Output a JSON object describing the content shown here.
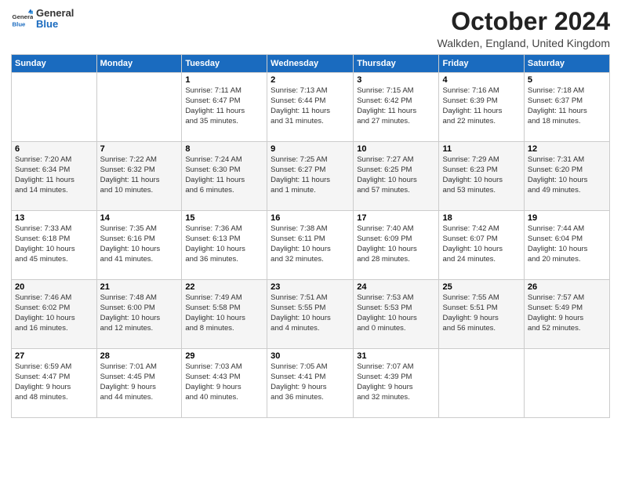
{
  "logo": {
    "general": "General",
    "blue": "Blue"
  },
  "header": {
    "title": "October 2024",
    "location": "Walkden, England, United Kingdom"
  },
  "days_of_week": [
    "Sunday",
    "Monday",
    "Tuesday",
    "Wednesday",
    "Thursday",
    "Friday",
    "Saturday"
  ],
  "weeks": [
    [
      {
        "day": "",
        "info": ""
      },
      {
        "day": "",
        "info": ""
      },
      {
        "day": "1",
        "info": "Sunrise: 7:11 AM\nSunset: 6:47 PM\nDaylight: 11 hours\nand 35 minutes."
      },
      {
        "day": "2",
        "info": "Sunrise: 7:13 AM\nSunset: 6:44 PM\nDaylight: 11 hours\nand 31 minutes."
      },
      {
        "day": "3",
        "info": "Sunrise: 7:15 AM\nSunset: 6:42 PM\nDaylight: 11 hours\nand 27 minutes."
      },
      {
        "day": "4",
        "info": "Sunrise: 7:16 AM\nSunset: 6:39 PM\nDaylight: 11 hours\nand 22 minutes."
      },
      {
        "day": "5",
        "info": "Sunrise: 7:18 AM\nSunset: 6:37 PM\nDaylight: 11 hours\nand 18 minutes."
      }
    ],
    [
      {
        "day": "6",
        "info": "Sunrise: 7:20 AM\nSunset: 6:34 PM\nDaylight: 11 hours\nand 14 minutes."
      },
      {
        "day": "7",
        "info": "Sunrise: 7:22 AM\nSunset: 6:32 PM\nDaylight: 11 hours\nand 10 minutes."
      },
      {
        "day": "8",
        "info": "Sunrise: 7:24 AM\nSunset: 6:30 PM\nDaylight: 11 hours\nand 6 minutes."
      },
      {
        "day": "9",
        "info": "Sunrise: 7:25 AM\nSunset: 6:27 PM\nDaylight: 11 hours\nand 1 minute."
      },
      {
        "day": "10",
        "info": "Sunrise: 7:27 AM\nSunset: 6:25 PM\nDaylight: 10 hours\nand 57 minutes."
      },
      {
        "day": "11",
        "info": "Sunrise: 7:29 AM\nSunset: 6:23 PM\nDaylight: 10 hours\nand 53 minutes."
      },
      {
        "day": "12",
        "info": "Sunrise: 7:31 AM\nSunset: 6:20 PM\nDaylight: 10 hours\nand 49 minutes."
      }
    ],
    [
      {
        "day": "13",
        "info": "Sunrise: 7:33 AM\nSunset: 6:18 PM\nDaylight: 10 hours\nand 45 minutes."
      },
      {
        "day": "14",
        "info": "Sunrise: 7:35 AM\nSunset: 6:16 PM\nDaylight: 10 hours\nand 41 minutes."
      },
      {
        "day": "15",
        "info": "Sunrise: 7:36 AM\nSunset: 6:13 PM\nDaylight: 10 hours\nand 36 minutes."
      },
      {
        "day": "16",
        "info": "Sunrise: 7:38 AM\nSunset: 6:11 PM\nDaylight: 10 hours\nand 32 minutes."
      },
      {
        "day": "17",
        "info": "Sunrise: 7:40 AM\nSunset: 6:09 PM\nDaylight: 10 hours\nand 28 minutes."
      },
      {
        "day": "18",
        "info": "Sunrise: 7:42 AM\nSunset: 6:07 PM\nDaylight: 10 hours\nand 24 minutes."
      },
      {
        "day": "19",
        "info": "Sunrise: 7:44 AM\nSunset: 6:04 PM\nDaylight: 10 hours\nand 20 minutes."
      }
    ],
    [
      {
        "day": "20",
        "info": "Sunrise: 7:46 AM\nSunset: 6:02 PM\nDaylight: 10 hours\nand 16 minutes."
      },
      {
        "day": "21",
        "info": "Sunrise: 7:48 AM\nSunset: 6:00 PM\nDaylight: 10 hours\nand 12 minutes."
      },
      {
        "day": "22",
        "info": "Sunrise: 7:49 AM\nSunset: 5:58 PM\nDaylight: 10 hours\nand 8 minutes."
      },
      {
        "day": "23",
        "info": "Sunrise: 7:51 AM\nSunset: 5:55 PM\nDaylight: 10 hours\nand 4 minutes."
      },
      {
        "day": "24",
        "info": "Sunrise: 7:53 AM\nSunset: 5:53 PM\nDaylight: 10 hours\nand 0 minutes."
      },
      {
        "day": "25",
        "info": "Sunrise: 7:55 AM\nSunset: 5:51 PM\nDaylight: 9 hours\nand 56 minutes."
      },
      {
        "day": "26",
        "info": "Sunrise: 7:57 AM\nSunset: 5:49 PM\nDaylight: 9 hours\nand 52 minutes."
      }
    ],
    [
      {
        "day": "27",
        "info": "Sunrise: 6:59 AM\nSunset: 4:47 PM\nDaylight: 9 hours\nand 48 minutes."
      },
      {
        "day": "28",
        "info": "Sunrise: 7:01 AM\nSunset: 4:45 PM\nDaylight: 9 hours\nand 44 minutes."
      },
      {
        "day": "29",
        "info": "Sunrise: 7:03 AM\nSunset: 4:43 PM\nDaylight: 9 hours\nand 40 minutes."
      },
      {
        "day": "30",
        "info": "Sunrise: 7:05 AM\nSunset: 4:41 PM\nDaylight: 9 hours\nand 36 minutes."
      },
      {
        "day": "31",
        "info": "Sunrise: 7:07 AM\nSunset: 4:39 PM\nDaylight: 9 hours\nand 32 minutes."
      },
      {
        "day": "",
        "info": ""
      },
      {
        "day": "",
        "info": ""
      }
    ]
  ]
}
